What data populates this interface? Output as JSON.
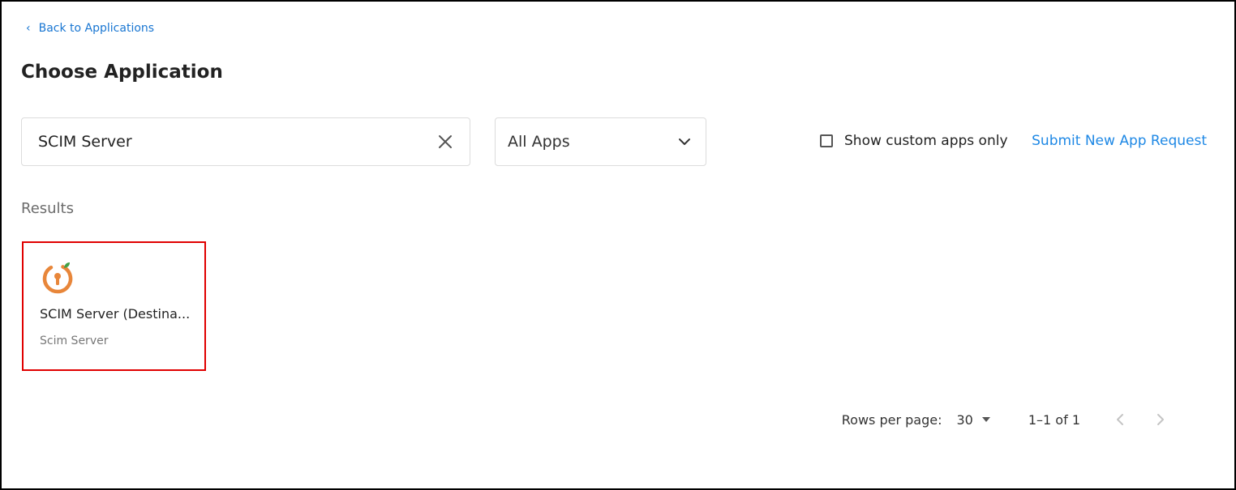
{
  "nav": {
    "back_label": "Back to Applications"
  },
  "page": {
    "title": "Choose Application"
  },
  "filters": {
    "search_value": "SCIM Server",
    "category_selected": "All Apps",
    "custom_only_label": "Show custom apps only",
    "custom_only_checked": false,
    "submit_request_label": "Submit New App Request"
  },
  "results": {
    "heading": "Results",
    "apps": [
      {
        "name": "SCIM Server (Destina...",
        "subtitle": "Scim Server",
        "icon": "scim-server-logo"
      }
    ]
  },
  "pagination": {
    "rows_per_page_label": "Rows per page:",
    "rows_per_page_value": "30",
    "range": "1–1 of 1"
  },
  "colors": {
    "link": "#1976d2",
    "highlight_border": "#e00000",
    "logo_orange": "#e8863a",
    "logo_leaf": "#43a047"
  }
}
